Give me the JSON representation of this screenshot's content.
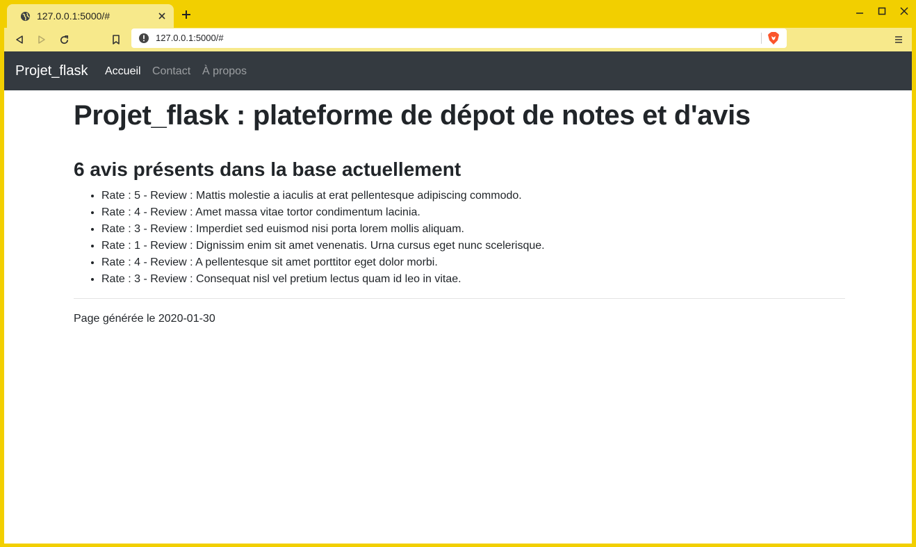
{
  "browser": {
    "tab_title": "127.0.0.1:5000/#",
    "url": "127.0.0.1:5000/#",
    "chrome_color": "#f2cf00",
    "toolbar_color": "#f7e98b"
  },
  "navbar": {
    "brand": "Projet_flask",
    "links": [
      {
        "label": "Accueil",
        "active": true
      },
      {
        "label": "Contact",
        "active": false
      },
      {
        "label": "À propos",
        "active": false
      }
    ],
    "background": "#343a40"
  },
  "main": {
    "title": "Projet_flask : plateforme de dépot de notes et d'avis",
    "subtitle": "6 avis présents dans la base actuellement",
    "reviews": [
      "Rate : 5 - Review : Mattis molestie a iaculis at erat pellentesque adipiscing commodo.",
      "Rate : 4 - Review : Amet massa vitae tortor condimentum lacinia.",
      "Rate : 3 - Review : Imperdiet sed euismod nisi porta lorem mollis aliquam.",
      "Rate : 1 - Review : Dignissim enim sit amet venenatis. Urna cursus eget nunc scelerisque.",
      "Rate : 4 - Review : A pellentesque sit amet porttitor eget dolor morbi.",
      "Rate : 3 - Review : Consequat nisl vel pretium lectus quam id leo in vitae."
    ],
    "footer": "Page générée le 2020-01-30"
  },
  "icons": {
    "tab_favicon": "globe-icon",
    "tab_close": "close-icon",
    "new_tab": "plus-icon",
    "back": "back-icon",
    "forward": "forward-icon",
    "reload": "reload-icon",
    "bookmark": "bookmark-icon",
    "site_info": "info-icon",
    "brave_shield": "brave-shield-icon",
    "menu": "hamburger-menu-icon"
  }
}
